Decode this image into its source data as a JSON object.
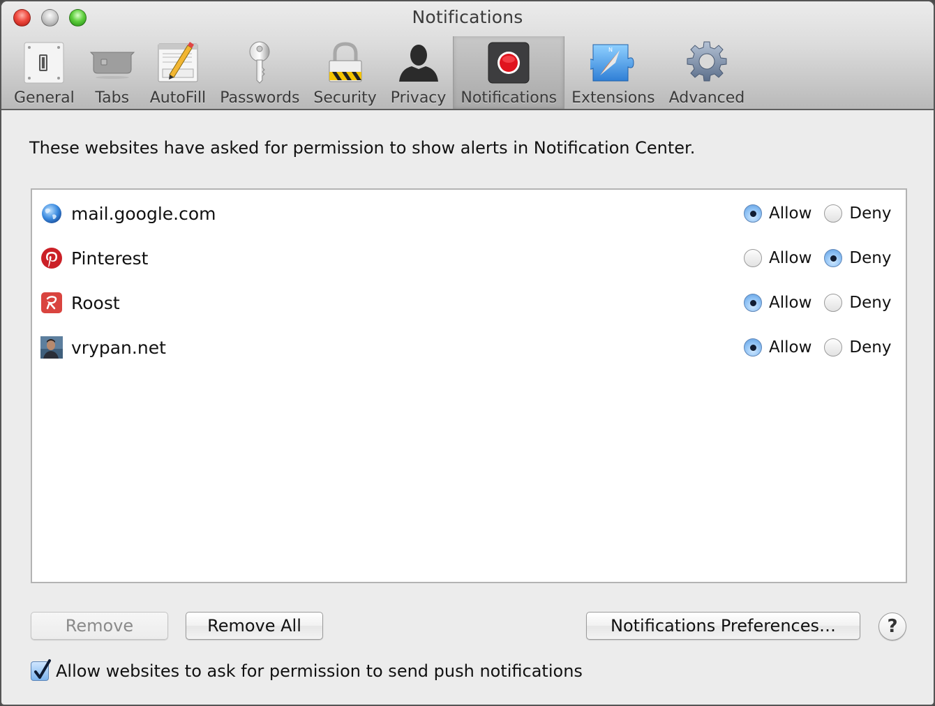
{
  "window": {
    "title": "Notifications"
  },
  "toolbar": {
    "tabs": [
      {
        "label": "General",
        "icon": "light-switch-icon",
        "selected": false
      },
      {
        "label": "Tabs",
        "icon": "tabs-icon",
        "selected": false
      },
      {
        "label": "AutoFill",
        "icon": "autofill-pencil-icon",
        "selected": false
      },
      {
        "label": "Passwords",
        "icon": "key-icon",
        "selected": false
      },
      {
        "label": "Security",
        "icon": "padlock-icon",
        "selected": false
      },
      {
        "label": "Privacy",
        "icon": "person-silhouette-icon",
        "selected": false
      },
      {
        "label": "Notifications",
        "icon": "notification-record-icon",
        "selected": true
      },
      {
        "label": "Extensions",
        "icon": "compass-puzzle-icon",
        "selected": false
      },
      {
        "label": "Advanced",
        "icon": "gear-icon",
        "selected": false
      }
    ]
  },
  "main": {
    "description": "These websites have asked for permission to show alerts in Notification Center.",
    "allow_label": "Allow",
    "deny_label": "Deny",
    "websites": [
      {
        "name": "mail.google.com",
        "icon": "globe-icon",
        "permission": "allow"
      },
      {
        "name": "Pinterest",
        "icon": "pinterest-icon",
        "permission": "deny"
      },
      {
        "name": "Roost",
        "icon": "roost-icon",
        "permission": "allow"
      },
      {
        "name": "vrypan.net",
        "icon": "user-photo-icon",
        "permission": "allow"
      }
    ]
  },
  "buttons": {
    "remove": "Remove",
    "remove_enabled": false,
    "remove_all": "Remove All",
    "notifications_preferences": "Notifications Preferences…",
    "help": "?"
  },
  "footer": {
    "allow_push_label": "Allow websites to ask for permission to send push notifications",
    "allow_push_checked": true
  },
  "colors": {
    "notification_red": "#e0141e",
    "pinterest_red": "#cb2027",
    "roost_red": "#d9443f",
    "radio_selected_blue": "#8ec1f4"
  }
}
